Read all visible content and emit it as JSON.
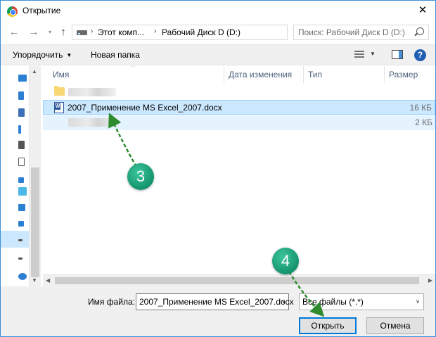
{
  "window": {
    "title": "Открытие",
    "close_glyph": "✕"
  },
  "address": {
    "breadcrumbs": [
      "Этот комп...",
      "Рабочий Диск D (D:)"
    ],
    "search_placeholder": "Поиск: Рабочий Диск D (D:)"
  },
  "toolbar": {
    "organize_label": "Упорядочить",
    "new_folder_label": "Новая папка",
    "help_label": "?"
  },
  "filelist": {
    "columns": [
      "Имя",
      "Дата изменения",
      "Тип",
      "Размер"
    ],
    "rows": [
      {
        "name": "",
        "size": "",
        "kind": "folder"
      },
      {
        "name": "2007_Применение MS Excel_2007.docx",
        "size": "16 КБ",
        "kind": "word"
      },
      {
        "name": "",
        "size": "2 КБ",
        "kind": "file"
      }
    ]
  },
  "footer": {
    "filename_label": "Имя файла:",
    "filename_value": "2007_Применение MS Excel_2007.docx",
    "filetype_value": "Все файлы (*.*)",
    "open_label": "Открыть",
    "cancel_label": "Отмена"
  },
  "annotations": {
    "marker_3": "3",
    "marker_4": "4",
    "marker_color": "#1b9e77",
    "arrow_color": "#2e8b2e"
  }
}
